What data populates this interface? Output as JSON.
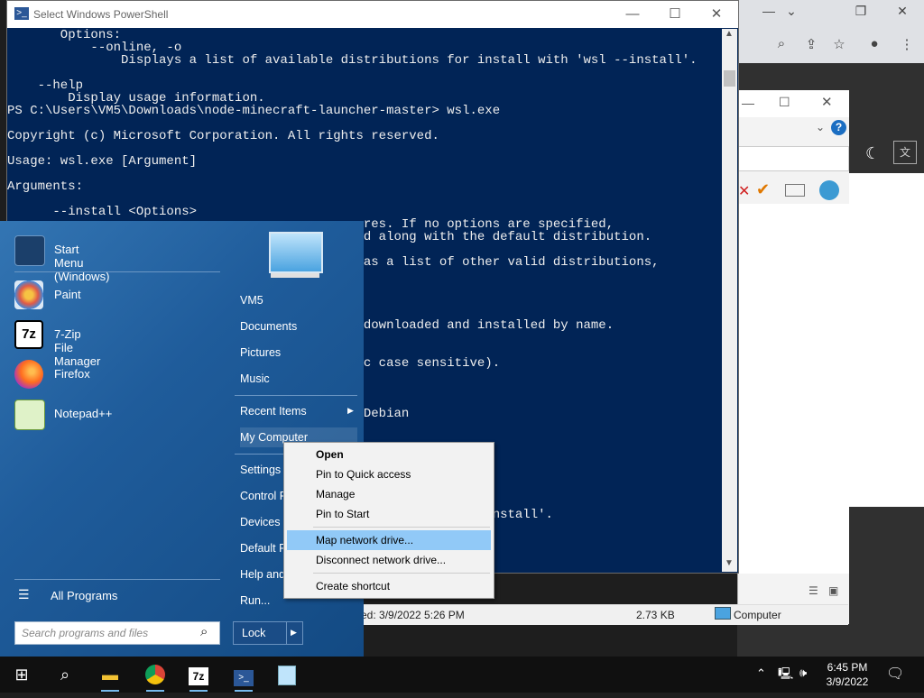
{
  "powershell": {
    "title": "Select Windows PowerShell",
    "lines": [
      "       Options:",
      "           --online, -o",
      "               Displays a list of available distributions for install with 'wsl --install'.",
      "",
      "    --help",
      "        Display usage information.",
      "PS C:\\Users\\VM5\\Downloads\\node-minecraft-launcher-master> wsl.exe",
      "",
      "Copyright (c) Microsoft Corporation. All rights reserved.",
      "",
      "Usage: wsl.exe [Argument]",
      "",
      "Arguments:",
      "",
      "      --install <Options>",
      "                                               res. If no options are specified,",
      "                                               d along with the default distribution.",
      "",
      "                                               as a list of other valid distributions,",
      "",
      "",
      "",
      "",
      "                                               downloaded and installed by name.",
      "",
      "",
      "                                               c case sensitive).",
      "",
      "",
      "",
      "                                               Debian",
      "",
      "",
      "",
      "",
      "",
      "",
      "",
      "                                               all with 'wsl --install'."
    ]
  },
  "start_menu": {
    "apps": [
      {
        "label": "Start Menu (Windows)",
        "icon": "start-menu-icon"
      },
      {
        "label": "Paint",
        "icon": "paint-icon"
      },
      {
        "label": "7-Zip File Manager",
        "icon": "7zip-icon"
      },
      {
        "label": "Firefox",
        "icon": "firefox-icon"
      },
      {
        "label": "Notepad++",
        "icon": "notepad-plus-plus-icon"
      }
    ],
    "all_programs": "All Programs",
    "search_placeholder": "Search programs and files",
    "right_items": [
      "VM5",
      "Documents",
      "Pictures",
      "Music",
      "Recent Items",
      "My Computer",
      "Settings",
      "Control P",
      "Devices a",
      "Default P",
      "Help and",
      "Run..."
    ],
    "lock": "Lock"
  },
  "context_menu": {
    "items": [
      "Open",
      "Pin to Quick access",
      "Manage",
      "Pin to Start",
      "Map network drive...",
      "Disconnect network drive...",
      "Create shortcut"
    ],
    "highlighted": "Map network drive..."
  },
  "explorer": {
    "status_modified": "ed: 3/9/2022 5:26 PM",
    "status_size": "2.73 KB",
    "status_location": "Computer"
  },
  "taskbar": {
    "time": "6:45 PM",
    "date": "3/9/2022"
  },
  "colors": {
    "powershell_bg": "#012456",
    "start_menu_bg": "#1f5c9b",
    "context_highlight": "#91c9f7"
  }
}
